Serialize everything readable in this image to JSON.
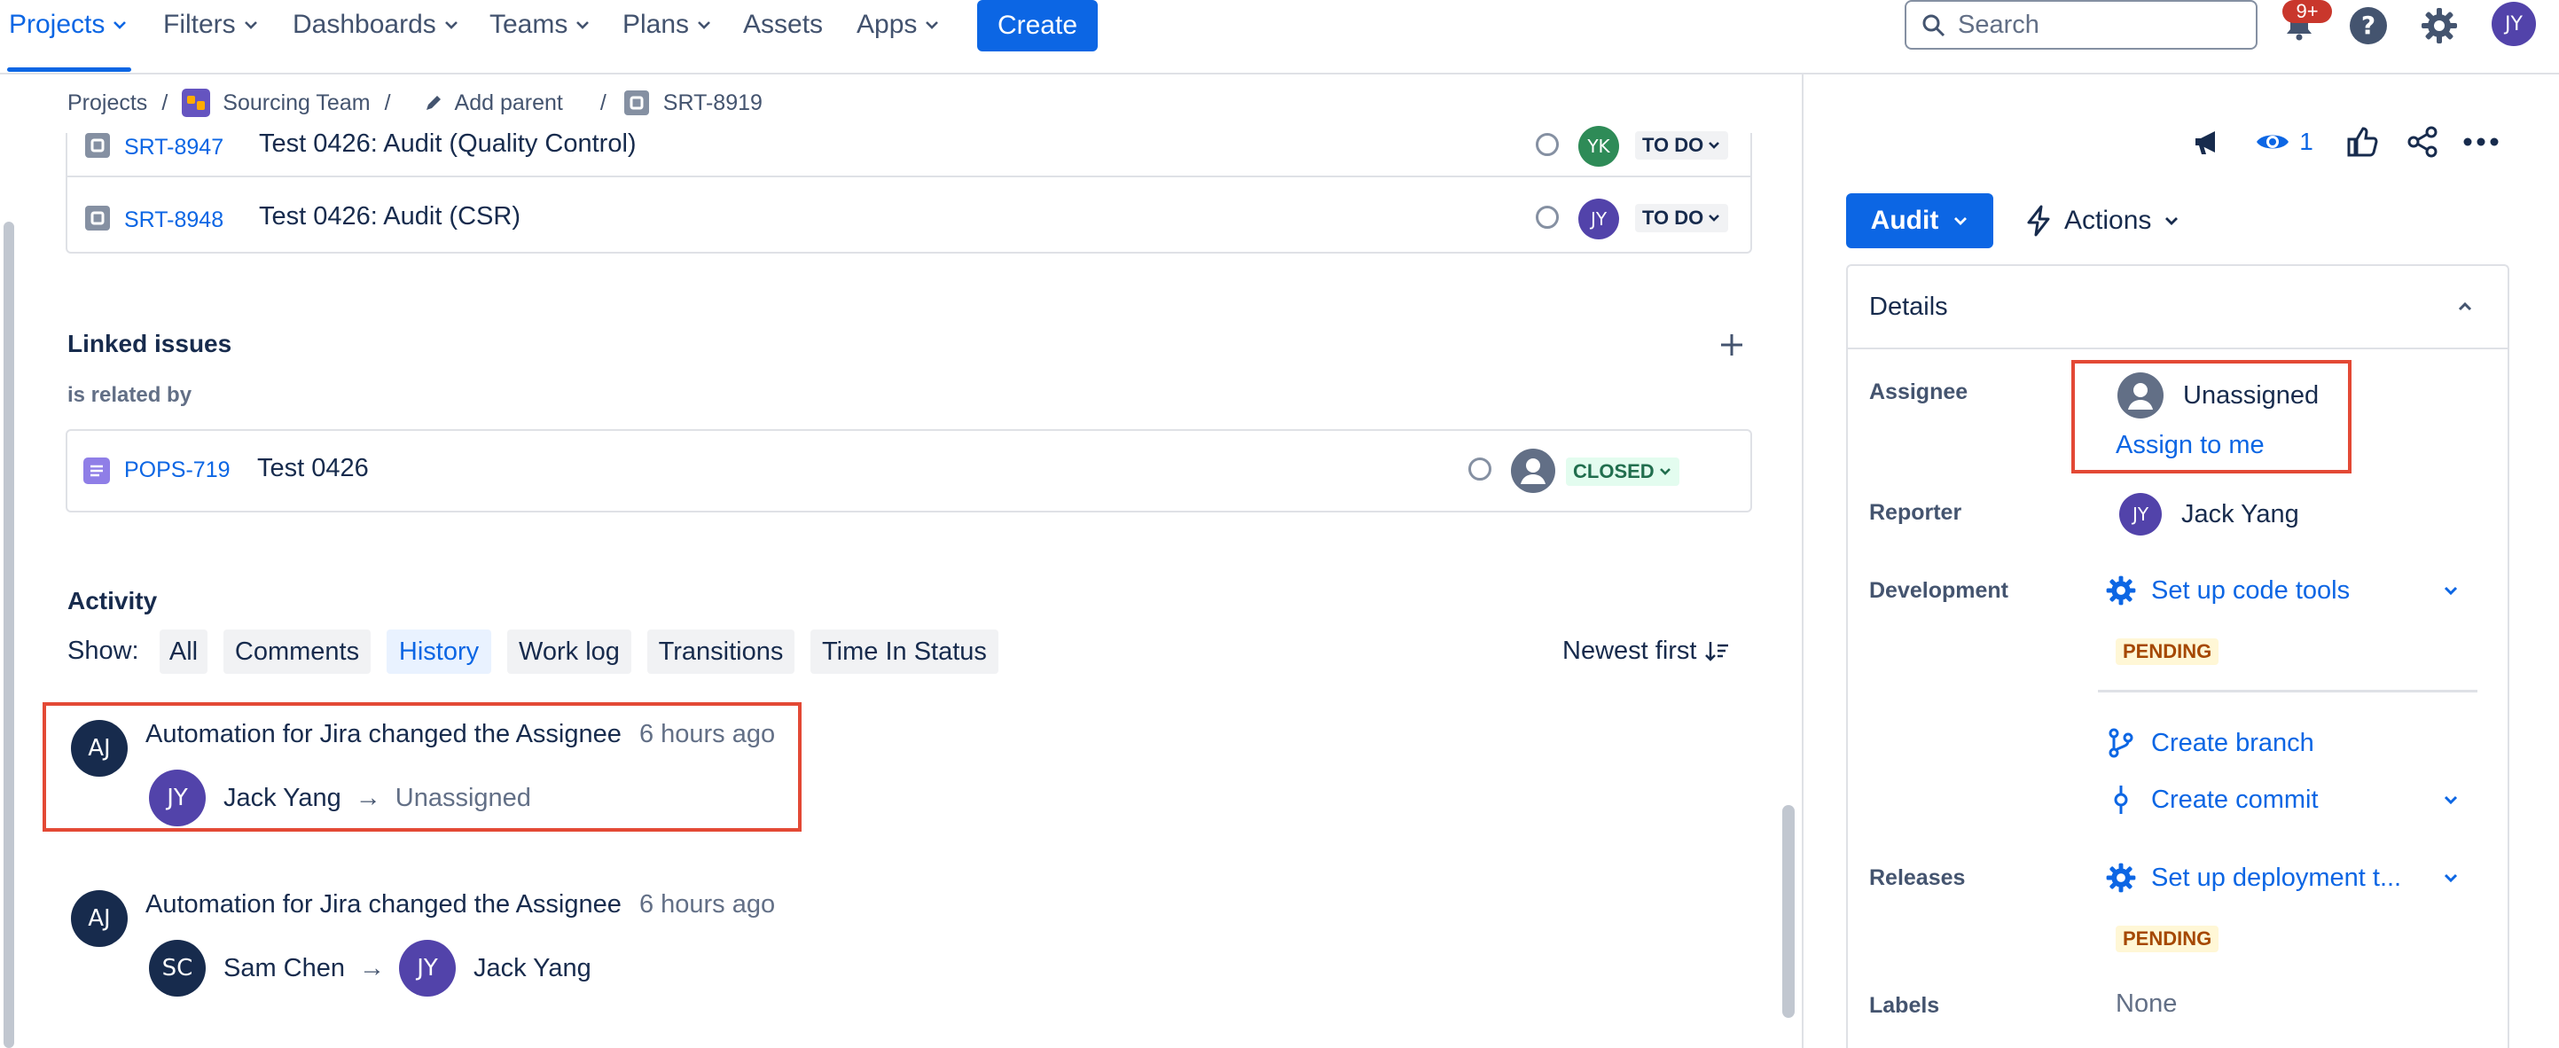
{
  "nav": {
    "items": [
      "Projects",
      "Filters",
      "Dashboards",
      "Teams",
      "Plans",
      "Assets",
      "Apps"
    ],
    "create_label": "Create",
    "search_placeholder": "Search",
    "notification_count": "9+",
    "user_initials": "JY"
  },
  "breadcrumb": {
    "projects": "Projects",
    "team": "Sourcing Team",
    "add_parent": "Add parent",
    "issue_key": "SRT-8919"
  },
  "child_issues": [
    {
      "key": "SRT-8947",
      "summary": "Test 0426: Audit (Quality Control)",
      "assignee_initials": "YK",
      "assignee_color": "#2e8b57",
      "status": "TO DO"
    },
    {
      "key": "SRT-8948",
      "summary": "Test 0426: Audit (CSR)",
      "assignee_initials": "JY",
      "assignee_color": "#5243aa",
      "status": "TO DO"
    }
  ],
  "linked": {
    "title": "Linked issues",
    "relation": "is related by",
    "issue": {
      "key": "POPS-719",
      "summary": "Test 0426",
      "status": "CLOSED"
    }
  },
  "activity": {
    "title": "Activity",
    "show_label": "Show:",
    "filters": [
      "All",
      "Comments",
      "History",
      "Work log",
      "Transitions",
      "Time In Status"
    ],
    "active_filter": "History",
    "sort_label": "Newest first",
    "entries": [
      {
        "actor_initials": "AJ",
        "actor": "Automation for Jira",
        "verb": "changed the",
        "field": "Assignee",
        "time": "6 hours ago",
        "from_initials": "JY",
        "from": "Jack Yang",
        "to": "Unassigned"
      },
      {
        "actor_initials": "AJ",
        "actor": "Automation for Jira",
        "verb": "changed the",
        "field": "Assignee",
        "time": "6 hours ago",
        "from_initials": "SC",
        "from": "Sam Chen",
        "to_initials": "JY",
        "to": "Jack Yang"
      }
    ]
  },
  "sidebar": {
    "watchers_count": "1",
    "status_label": "Audit",
    "actions_label": "Actions",
    "details_title": "Details",
    "fields": {
      "assignee_label": "Assignee",
      "assignee_value": "Unassigned",
      "assign_to_me": "Assign to me",
      "reporter_label": "Reporter",
      "reporter_initials": "JY",
      "reporter_value": "Jack Yang",
      "development_label": "Development",
      "setup_code_tools": "Set up code tools",
      "pending": "PENDING",
      "create_branch": "Create branch",
      "create_commit": "Create commit",
      "releases_label": "Releases",
      "setup_deployment": "Set up deployment t...",
      "labels_label": "Labels",
      "labels_value": "None"
    }
  },
  "colors": {
    "accent": "#0c66e4",
    "highlight": "#e34935",
    "avatar_jy": "#5243aa",
    "avatar_dark": "#172b4d"
  }
}
